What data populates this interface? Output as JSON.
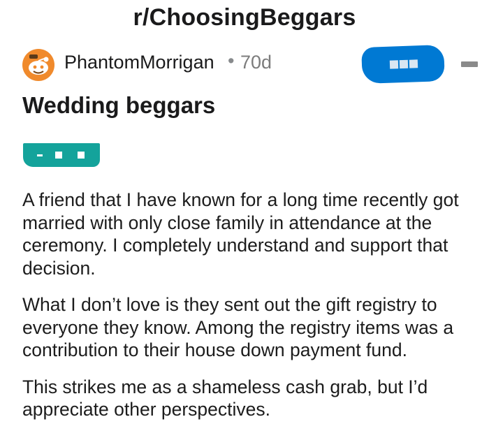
{
  "subreddit": {
    "name": "r/ChoosingBeggars"
  },
  "post": {
    "author": "PhantomMorrigan",
    "separator": "•",
    "age": "70d",
    "title": "Wedding beggars",
    "avatar_icon": "reddit-avatar-icon",
    "more_icon": "more-options-icon",
    "body": [
      "A friend that I have known for a long time recently got married with only close family in attendance at the ceremony. I completely understand and support that decision.",
      "What I don’t love is they sent out the gift registry to everyone they know. Among the registry items was a contribution to their house down payment fund.",
      "This strikes me as a shameless cash grab, but I’d appreciate other perspectives."
    ]
  },
  "colors": {
    "join_button": "#0079d3",
    "flair": "#14a39b",
    "avatar": "#f08a2c",
    "meta_text": "#7c7c7c"
  }
}
